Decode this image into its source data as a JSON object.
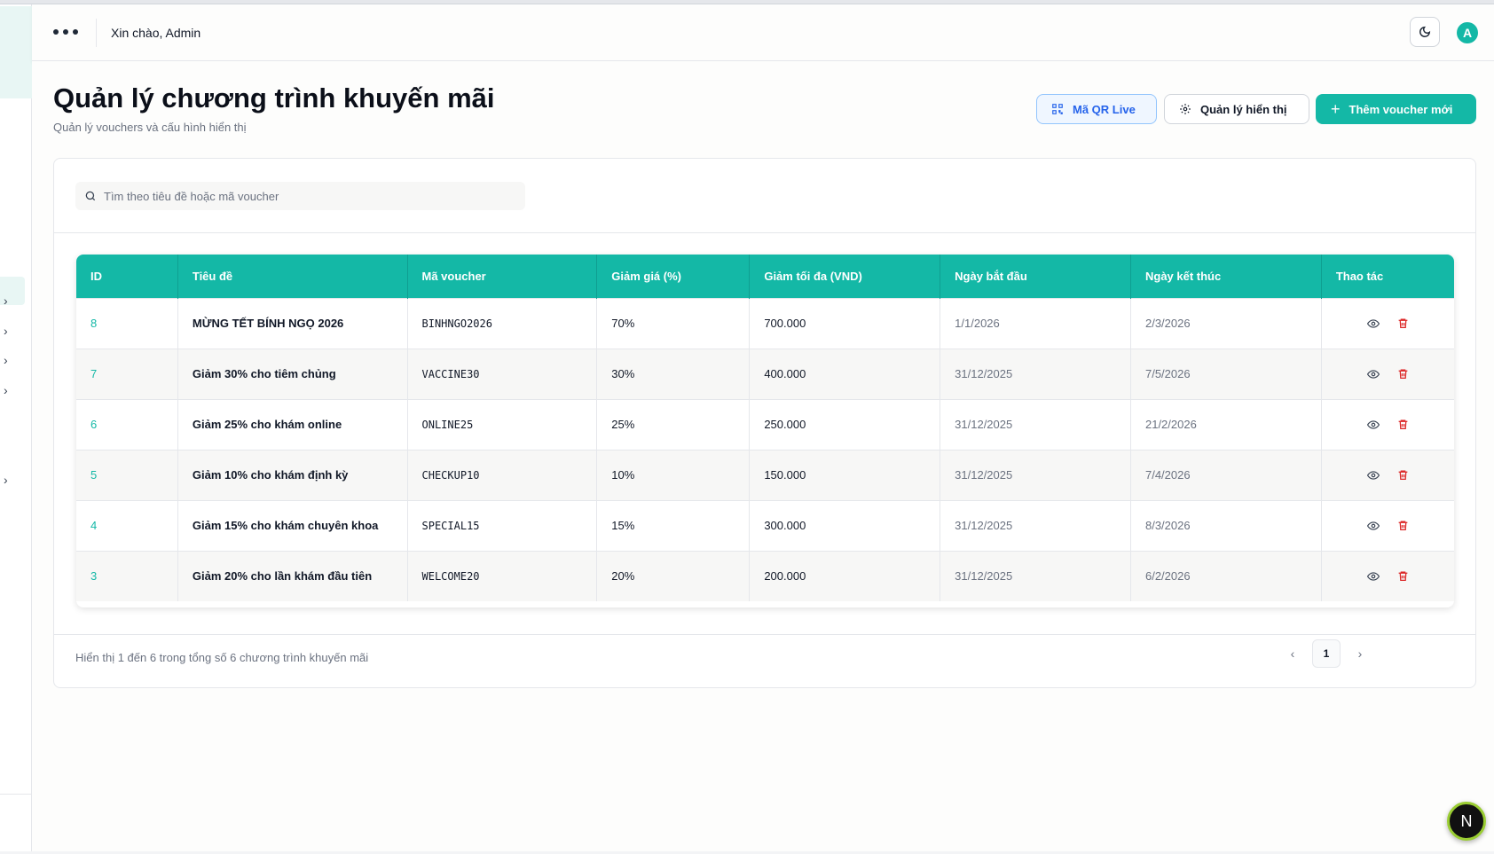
{
  "header": {
    "greeting": "Xin chào, Admin",
    "avatar_initial": "A"
  },
  "page": {
    "title": "Quản lý chương trình khuyến mãi",
    "subtitle": "Quản lý vouchers và cấu hình hiển thị"
  },
  "actions": {
    "qr_label": "Mã QR Live",
    "display_label": "Quản lý hiển thị",
    "add_label": "Thêm voucher mới"
  },
  "search": {
    "placeholder": "Tìm theo tiêu đề hoặc mã voucher",
    "value": ""
  },
  "table": {
    "columns": [
      "ID",
      "Tiêu đề",
      "Mã voucher",
      "Giảm giá (%)",
      "Giảm tối đa (VND)",
      "Ngày bắt đầu",
      "Ngày kết thúc",
      "Thao tác"
    ],
    "rows": [
      {
        "id": "8",
        "title": "MỪNG TẾT BÍNH NGỌ 2026",
        "code": "BINHNGO2026",
        "discount": "70%",
        "max": "700.000",
        "start": "1/1/2026",
        "end": "2/3/2026"
      },
      {
        "id": "7",
        "title": "Giảm 30% cho tiêm chủng",
        "code": "VACCINE30",
        "discount": "30%",
        "max": "400.000",
        "start": "31/12/2025",
        "end": "7/5/2026"
      },
      {
        "id": "6",
        "title": "Giảm 25% cho khám online",
        "code": "ONLINE25",
        "discount": "25%",
        "max": "250.000",
        "start": "31/12/2025",
        "end": "21/2/2026"
      },
      {
        "id": "5",
        "title": "Giảm 10% cho khám định kỳ",
        "code": "CHECKUP10",
        "discount": "10%",
        "max": "150.000",
        "start": "31/12/2025",
        "end": "7/4/2026"
      },
      {
        "id": "4",
        "title": "Giảm 15% cho khám chuyên khoa",
        "code": "SPECIAL15",
        "discount": "15%",
        "max": "300.000",
        "start": "31/12/2025",
        "end": "8/3/2026"
      },
      {
        "id": "3",
        "title": "Giảm 20% cho lần khám đầu tiên",
        "code": "WELCOME20",
        "discount": "20%",
        "max": "200.000",
        "start": "31/12/2025",
        "end": "6/2/2026"
      }
    ]
  },
  "pagination": {
    "summary": "Hiển thị 1 đến 6 trong tổng số 6 chương trình khuyến mãi",
    "current_page": "1"
  },
  "floating_badge": "N",
  "colors": {
    "accent": "#14b8a6",
    "qr_blue": "#2563eb",
    "delete_red": "#dc2626"
  },
  "icons": {
    "menu": "more-dots-icon",
    "theme": "theme-toggle-icon",
    "qr": "qr-code-icon",
    "settings": "gear-icon",
    "add": "plus-icon",
    "search": "search-icon",
    "view": "eye-icon",
    "delete": "trash-icon",
    "sidebar_expand": "chevron-right-icon"
  }
}
